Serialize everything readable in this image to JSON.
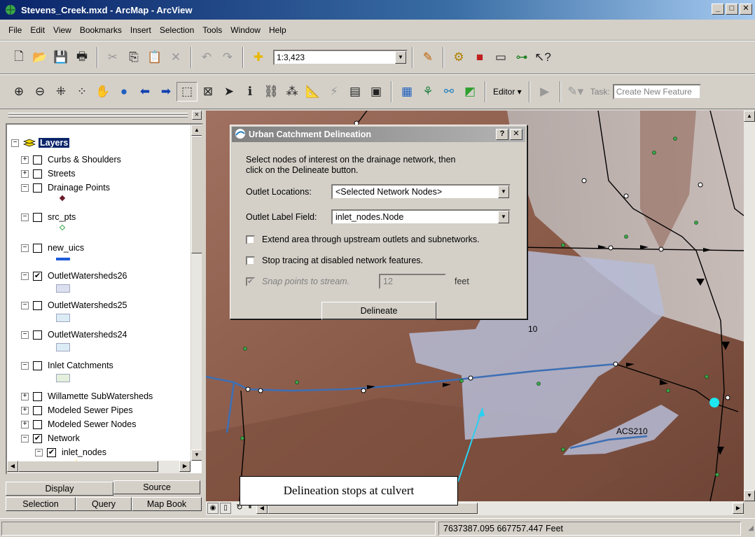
{
  "window": {
    "title": "Stevens_Creek.mxd - ArcMap - ArcView",
    "buttons": [
      "_",
      "□",
      "✕"
    ]
  },
  "menu": [
    "File",
    "Edit",
    "View",
    "Bookmarks",
    "Insert",
    "Selection",
    "Tools",
    "Window",
    "Help"
  ],
  "toolbar": {
    "scale": "1:3,423",
    "editor_label": "Editor ▾",
    "task_label": "Task:",
    "task_value": "Create New Feature"
  },
  "toc": {
    "title": "Layers",
    "layers": [
      {
        "label": "Curbs & Shoulders",
        "expander": "+",
        "checked": false
      },
      {
        "label": "Streets",
        "expander": "+",
        "checked": false
      },
      {
        "label": "Drainage Points",
        "expander": "−",
        "checked": false
      },
      {
        "label": "src_pts",
        "expander": "−",
        "checked": false
      },
      {
        "label": "new_uics",
        "expander": "−",
        "checked": false
      },
      {
        "label": "OutletWatersheds26",
        "expander": "−",
        "checked": true
      },
      {
        "label": "OutletWatersheds25",
        "expander": "−",
        "checked": false
      },
      {
        "label": "OutletWatersheds24",
        "expander": "−",
        "checked": false
      },
      {
        "label": "Inlet Catchments",
        "expander": "−",
        "checked": false
      },
      {
        "label": "Willamette SubWatersheds",
        "expander": "+",
        "checked": false
      },
      {
        "label": "Modeled Sewer Pipes",
        "expander": "+",
        "checked": false
      },
      {
        "label": "Modeled Sewer Nodes",
        "expander": "+",
        "checked": false
      },
      {
        "label": "Network",
        "expander": "−",
        "checked": true
      },
      {
        "label": "inlet_nodes",
        "expander": "−",
        "checked": true
      }
    ],
    "tabs": {
      "display": "Display",
      "source": "Source",
      "selection": "Selection",
      "query": "Query",
      "map_book": "Map Book"
    }
  },
  "dialog": {
    "title": "Urban Catchment Delineation",
    "help": "?",
    "close": "✕",
    "instructions_1": "Select nodes of interest on the drainage network, then",
    "instructions_2": "click on the Delineate button.",
    "outlet_locations_label": "Outlet Locations:",
    "outlet_locations_value": "<Selected Network Nodes>",
    "outlet_label_field_label": "Outlet Label Field:",
    "outlet_label_field_value": "inlet_nodes.Node",
    "extend_label": "Extend area through upstream outlets and subnetworks.",
    "stop_label": "Stop tracing at disabled network features.",
    "snap_label": "Snap points to stream.",
    "snap_value": "12",
    "snap_unit": "feet",
    "delineate_button": "Delineate"
  },
  "map": {
    "label_10": "10",
    "label_acs210": "ACS210"
  },
  "callout": "Delineation stops at culvert",
  "status": {
    "coordinates": "7637387.095  667757.447 Feet"
  },
  "colors": {
    "terrain": "#8a5a48",
    "watershed": "#b6bcd6",
    "stream": "#3d6fb4",
    "selected_node": "#1ee6f0"
  }
}
